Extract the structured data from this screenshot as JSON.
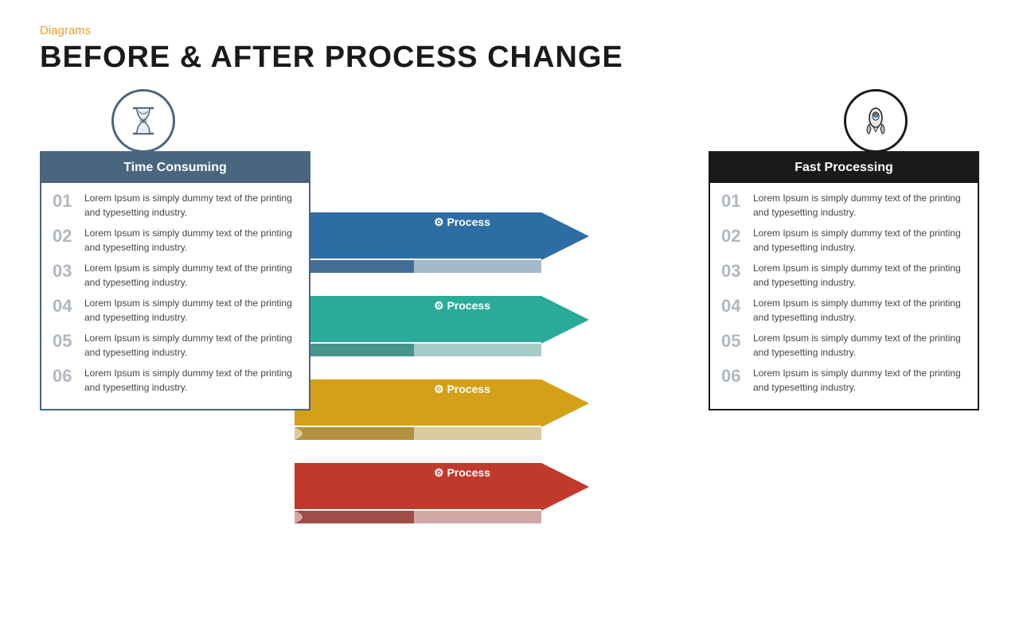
{
  "header": {
    "category": "Diagrams",
    "title": "BEFORE & AFTER PROCESS CHANGE"
  },
  "left": {
    "icon_label": "hourglass-icon",
    "header": "Time Consuming",
    "items": [
      {
        "num": "01",
        "text": "Lorem Ipsum is simply dummy text of the printing and typesetting industry."
      },
      {
        "num": "02",
        "text": "Lorem Ipsum is simply dummy text of the printing and typesetting industry."
      },
      {
        "num": "03",
        "text": "Lorem Ipsum is simply dummy text of the printing and typesetting industry."
      },
      {
        "num": "04",
        "text": "Lorem Ipsum is simply dummy text of the printing and typesetting industry."
      },
      {
        "num": "05",
        "text": "Lorem Ipsum is simply dummy text of the printing and typesetting industry."
      },
      {
        "num": "06",
        "text": "Lorem Ipsum is simply dummy text of the printing and typesetting industry."
      }
    ]
  },
  "right": {
    "icon_label": "rocket-icon",
    "header": "Fast Processing",
    "items": [
      {
        "num": "01",
        "text": "Lorem Ipsum is simply dummy text of the printing and typesetting industry."
      },
      {
        "num": "02",
        "text": "Lorem Ipsum is simply dummy text of the printing and typesetting industry."
      },
      {
        "num": "03",
        "text": "Lorem Ipsum is simply dummy text of the printing and typesetting industry."
      },
      {
        "num": "04",
        "text": "Lorem Ipsum is simply dummy text of the printing and typesetting industry."
      },
      {
        "num": "05",
        "text": "Lorem Ipsum is simply dummy text of the printing and typesetting industry."
      },
      {
        "num": "06",
        "text": "Lorem Ipsum is simply dummy text of the printing and typesetting industry."
      }
    ]
  },
  "processes": [
    {
      "label": "Process",
      "color": "#2e6da4"
    },
    {
      "label": "Process",
      "color": "#2aab9a"
    },
    {
      "label": "Process",
      "color": "#d4a017"
    },
    {
      "label": "Process",
      "color": "#c0392b"
    }
  ],
  "colors": {
    "orange": "#e8a020",
    "dark_blue": "#4a6580",
    "black": "#1a1a1a",
    "blue": "#2e6da4",
    "teal": "#2aab9a",
    "gold": "#d4a017",
    "red": "#c0392b"
  }
}
